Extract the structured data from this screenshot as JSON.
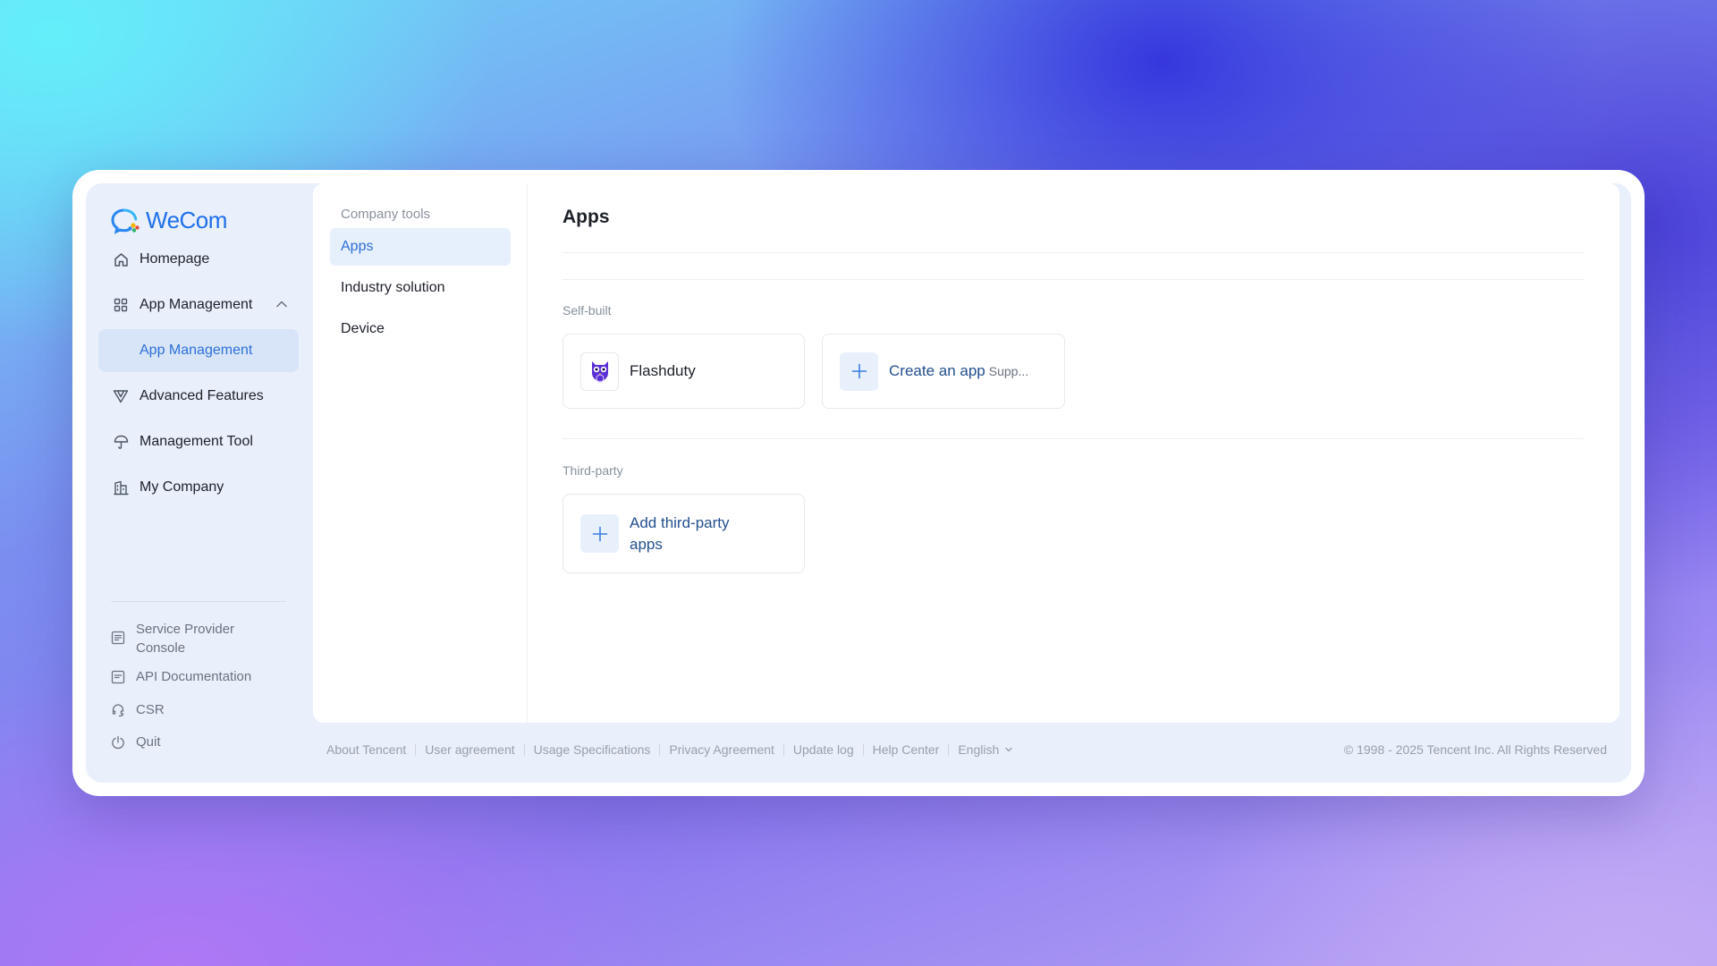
{
  "brand": {
    "name": "WeCom",
    "color": "#1f6fea"
  },
  "sidebar": {
    "items": [
      {
        "label": "Homepage",
        "icon": "home-icon"
      },
      {
        "label": "App Management",
        "icon": "grid-icon",
        "expanded": true
      },
      {
        "label": "Advanced Features",
        "icon": "advanced-icon"
      },
      {
        "label": "Management Tool",
        "icon": "umbrella-icon"
      },
      {
        "label": "My Company",
        "icon": "building-icon"
      }
    ],
    "sub_item": {
      "label": "App Management",
      "active": true
    },
    "bottom": [
      {
        "label": "Service Provider Console",
        "icon": "console-icon"
      },
      {
        "label": "API Documentation",
        "icon": "doc-icon"
      },
      {
        "label": "CSR",
        "icon": "headset-icon"
      },
      {
        "label": "Quit",
        "icon": "power-icon"
      }
    ]
  },
  "subnav": {
    "title": "Company tools",
    "items": [
      {
        "label": "Apps",
        "active": true
      },
      {
        "label": "Industry solution"
      },
      {
        "label": "Device"
      }
    ]
  },
  "main": {
    "title": "Apps",
    "self_built": {
      "label": "Self-built",
      "app": {
        "name": "Flashduty",
        "icon": "flashduty-owl-icon"
      },
      "create": {
        "label": "Create an app",
        "sub": "Supp..."
      }
    },
    "third_party": {
      "label": "Third-party",
      "add": {
        "label_line1": "Add third-party",
        "label_line2": "apps"
      }
    }
  },
  "footer": {
    "links": [
      "About Tencent",
      "User agreement",
      "Usage Specifications",
      "Privacy Agreement",
      "Update log",
      "Help Center"
    ],
    "language": "English",
    "copyright": "© 1998 - 2025 Tencent Inc. All Rights Reserved"
  },
  "colors": {
    "accent": "#2d6fd8",
    "active_bg": "#d8e5f8",
    "frame_bg": "#e9f0fb"
  }
}
